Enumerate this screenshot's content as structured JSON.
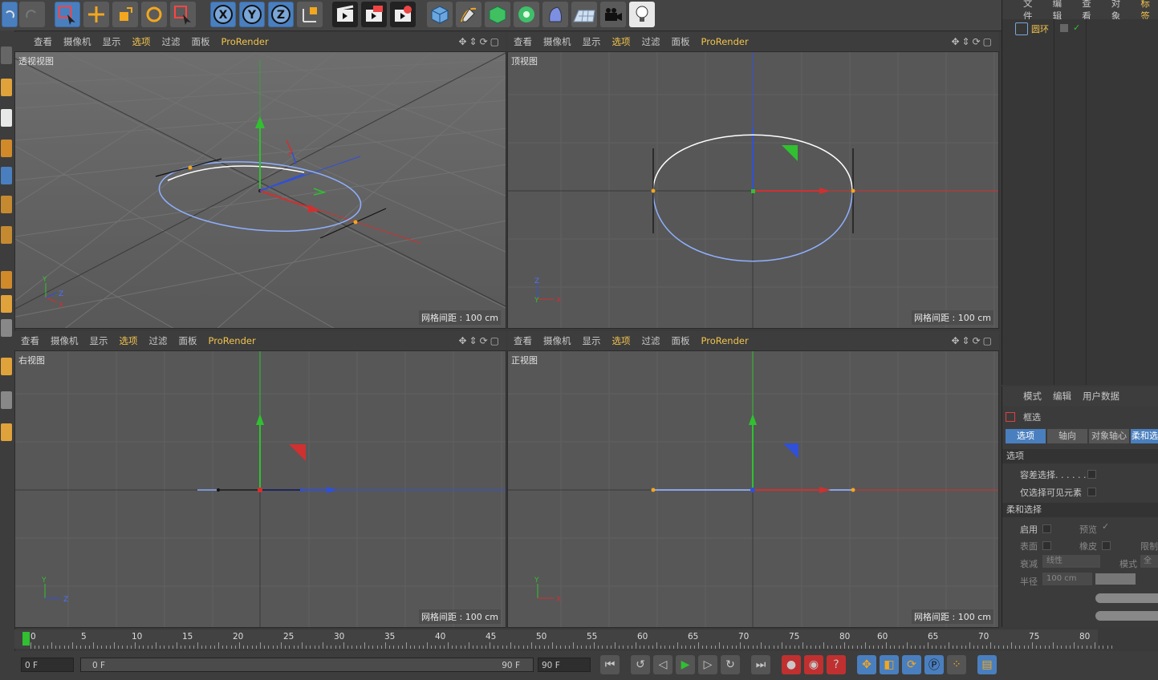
{
  "viewport_menu": {
    "view": "查看",
    "camera": "摄像机",
    "display": "显示",
    "options": "选项",
    "filter": "过滤",
    "panel": "面板",
    "prorender": "ProRender"
  },
  "viewports": {
    "perspective": {
      "name": "透视视图",
      "grid": "网格间距 : 100 cm"
    },
    "top": {
      "name": "顶视图",
      "grid": "网格间距 : 100 cm"
    },
    "right": {
      "name": "右视图",
      "grid": "网格间距 : 100 cm"
    },
    "front": {
      "name": "正视图",
      "grid": "网格间距 : 100 cm"
    }
  },
  "axis_labels": {
    "x": "X",
    "y": "Y",
    "z": "Z"
  },
  "object_manager": {
    "menu": [
      "文件",
      "编辑",
      "查看",
      "对象",
      "标签"
    ],
    "object_name": "圆环"
  },
  "attribute_manager": {
    "menu": [
      "模式",
      "编辑",
      "用户数据"
    ],
    "tool_name": "框选",
    "tabs": [
      "选项",
      "轴向",
      "对象轴心",
      "柔和选"
    ],
    "section_options": "选项",
    "tolerant_select": "容差选择. . . . . .",
    "only_visible": "仅选择可见元素",
    "section_soft": "柔和选择",
    "enable": "启用",
    "preview": "预览",
    "surface": "表面",
    "rubber": "橡皮",
    "limit": "限制",
    "falloff": "衰减",
    "falloff_value": "线性",
    "mode": "模式",
    "mode_value": "全",
    "radius": "半径",
    "radius_value": "100 cm"
  },
  "timeline": {
    "ticks_left": [
      "0",
      "5",
      "10",
      "15",
      "20",
      "25",
      "30",
      "35",
      "40",
      "45",
      "50",
      "55",
      "60",
      "65",
      "70",
      "75",
      "80"
    ],
    "ticks_right": [
      "60",
      "65",
      "70",
      "75",
      "80"
    ]
  },
  "transport": {
    "current_frame": "0 F",
    "range_start": "0 F",
    "range_end": "90 F",
    "end_frame": "90 F"
  },
  "colors": {
    "accent_blue": "#4a7fbf",
    "highlight_yellow": "#f2c44e",
    "x_axis": "#d03030",
    "y_axis": "#30c030",
    "z_axis": "#3050d8"
  }
}
